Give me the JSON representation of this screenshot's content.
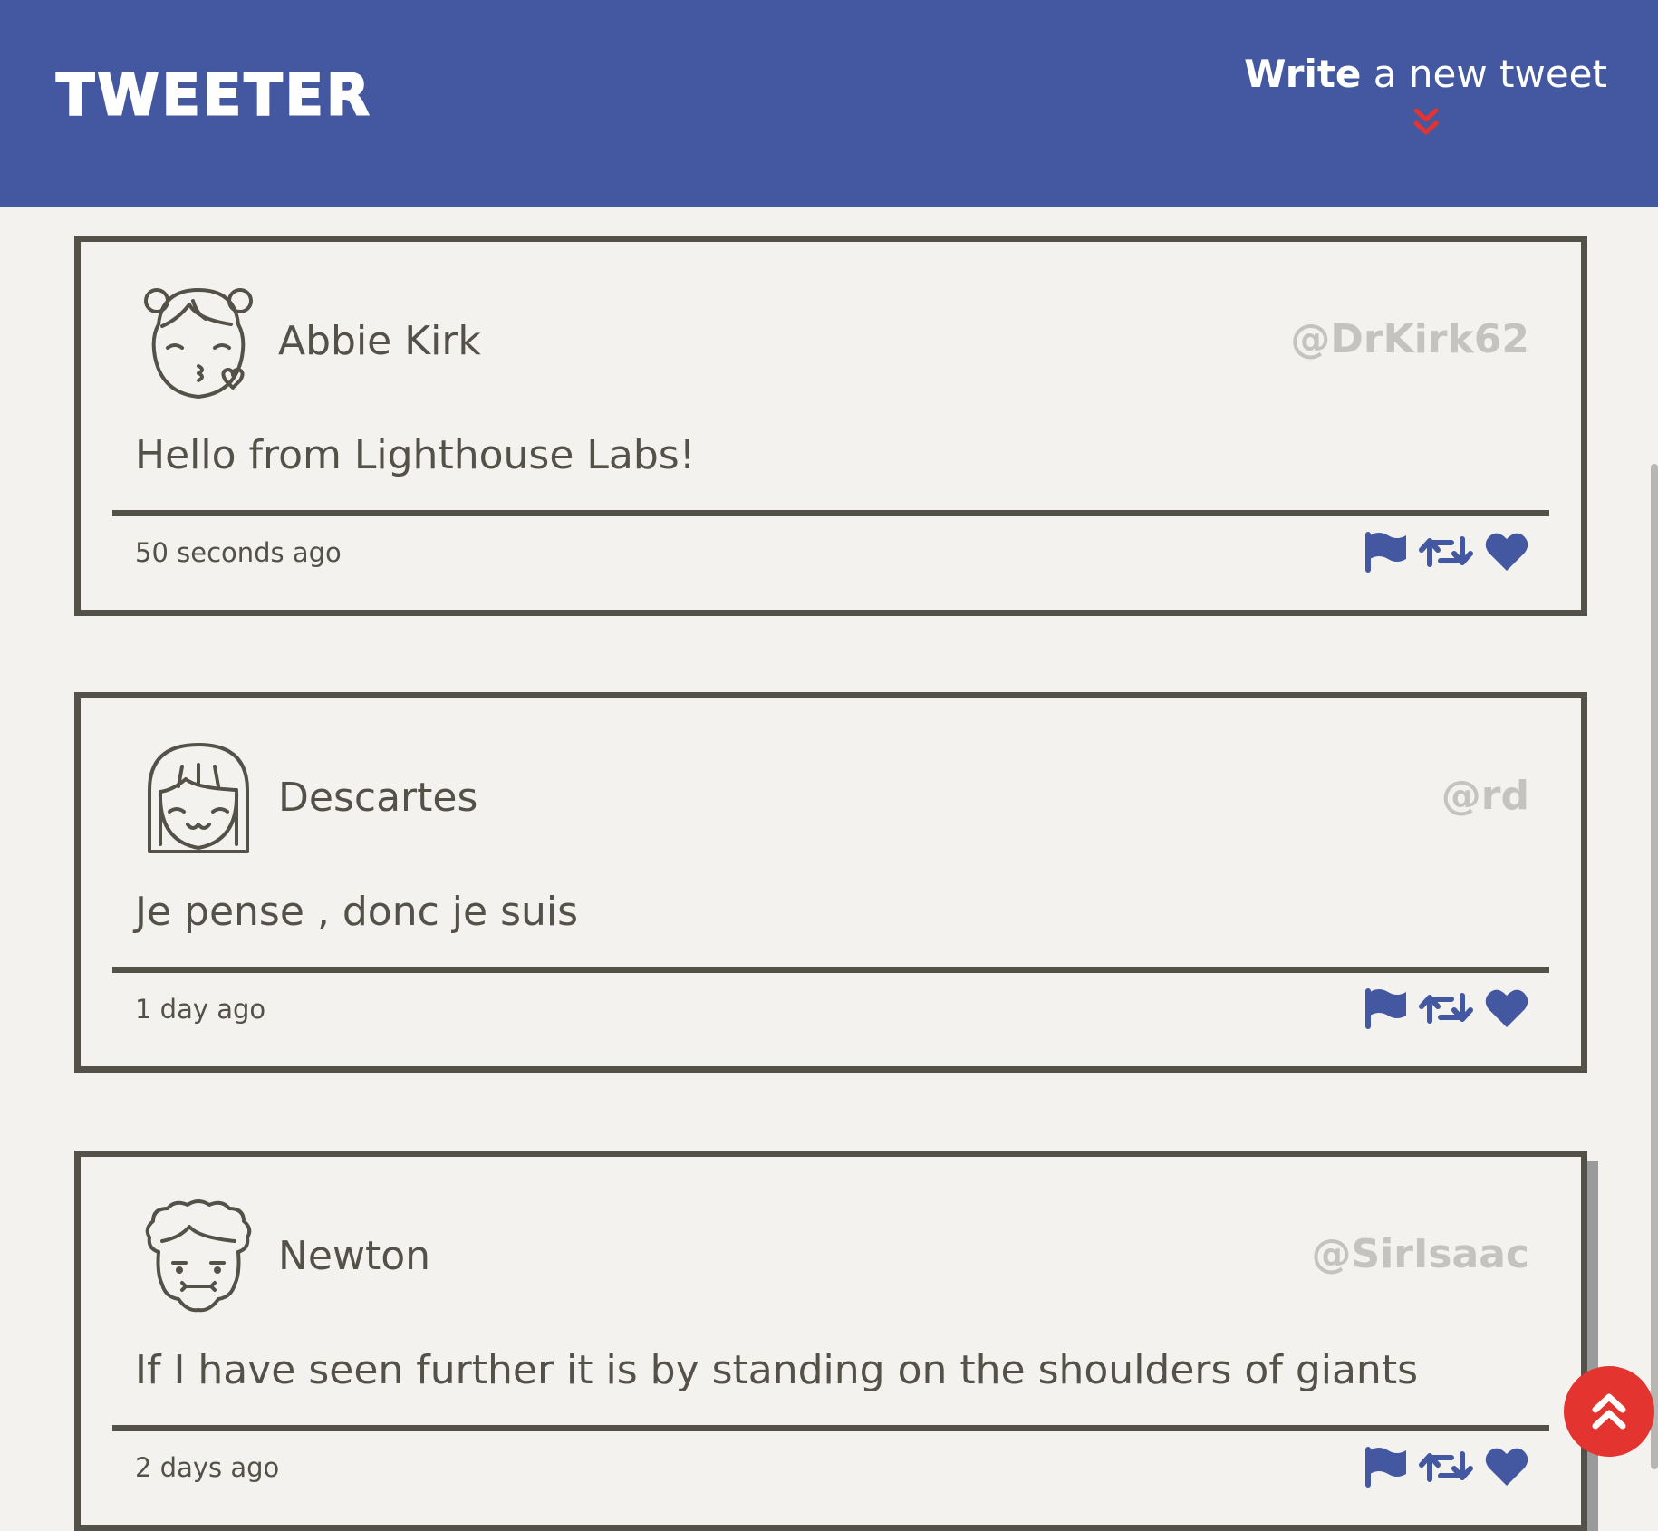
{
  "app": {
    "brand": "TWEETER",
    "compose": {
      "strong": "Write",
      "rest": " a new tweet",
      "arrow_icon": "double-chevron-down-icon",
      "arrow_color": "#e3342f"
    }
  },
  "colors": {
    "header_bg": "#4358a0",
    "page_bg": "#f4f2ee",
    "border": "#545149",
    "handle": "#c5c3bf",
    "action_icon": "#4358a0",
    "scroll_top_bg": "#e3342f"
  },
  "tweets": [
    {
      "avatar_icon": "girl-buns-kiss-avatar-icon",
      "name": "Abbie Kirk",
      "handle": "@DrKirk62",
      "text": "Hello from Lighthouse Labs!",
      "time": "50 seconds ago",
      "actions": [
        "flag-icon",
        "retweet-icon",
        "heart-icon"
      ]
    },
    {
      "avatar_icon": "girl-bob-avatar-icon",
      "name": "Descartes",
      "handle": "@rd",
      "text": "Je pense , donc je suis",
      "time": "1 day ago",
      "actions": [
        "flag-icon",
        "retweet-icon",
        "heart-icon"
      ]
    },
    {
      "avatar_icon": "curly-hair-avatar-icon",
      "name": "Newton",
      "handle": "@SirIsaac",
      "text": "If I have seen further it is by standing on the shoulders of giants",
      "time": "2 days ago",
      "actions": [
        "flag-icon",
        "retweet-icon",
        "heart-icon"
      ]
    }
  ],
  "scroll_top": {
    "icon": "double-chevron-up-icon"
  }
}
